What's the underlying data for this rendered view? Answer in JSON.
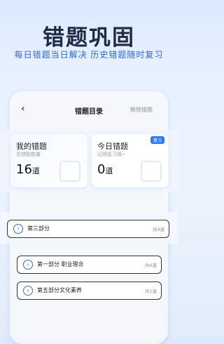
{
  "hero": {
    "title": "错题巩固",
    "subtitle": "每日错题当日解决 历史错题随时复习"
  },
  "nav": {
    "back": "‹",
    "title": "错题目录",
    "remove": "移除错题"
  },
  "cards": [
    {
      "title": "我的错题",
      "sub": "总错题数量",
      "num": "16",
      "unit": "道"
    },
    {
      "title": "今日错题",
      "sub": "记得复习哦~",
      "num": "0",
      "unit": "道",
      "badge": "复习"
    }
  ],
  "sections": [
    {
      "label": "第三部分",
      "count": "共9道"
    },
    {
      "label": "第一部分 职业理念",
      "count": "共6道"
    },
    {
      "label": "第五部分文化素养",
      "count": "共1道"
    }
  ],
  "colors": {
    "accent": "#2f7bf5"
  }
}
